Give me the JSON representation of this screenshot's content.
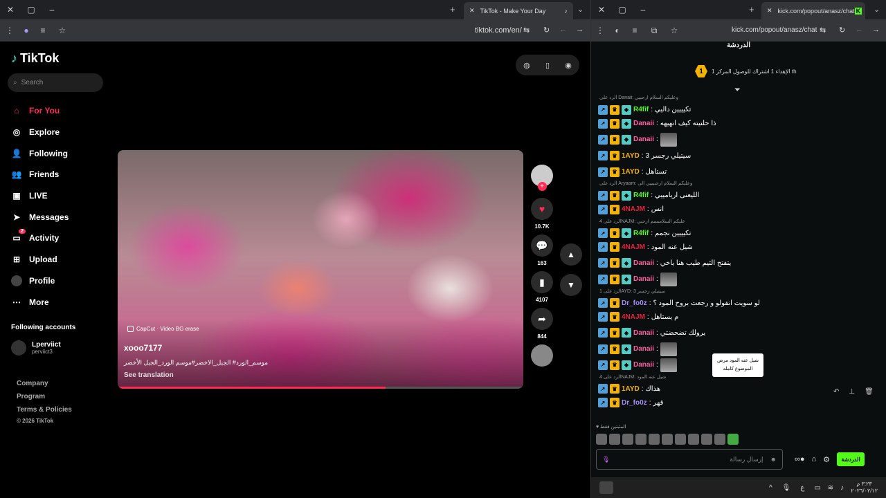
{
  "left_browser": {
    "tab_title": "TikTok - Make Your Day",
    "url": "tiktok.com/en/"
  },
  "tiktok": {
    "logo": "TikTok",
    "search_placeholder": "Search",
    "nav": [
      {
        "label": "For You",
        "icon": "home-icon",
        "active": true
      },
      {
        "label": "Explore",
        "icon": "compass-icon"
      },
      {
        "label": "Following",
        "icon": "person-icon"
      },
      {
        "label": "Friends",
        "icon": "friends-icon"
      },
      {
        "label": "LIVE",
        "icon": "live-icon"
      },
      {
        "label": "Messages",
        "icon": "send-icon"
      },
      {
        "label": "Activity",
        "icon": "activity-icon",
        "badge": "2"
      },
      {
        "label": "Upload",
        "icon": "upload-icon"
      },
      {
        "label": "Profile",
        "icon": "avatar-icon"
      },
      {
        "label": "More",
        "icon": "more-icon"
      }
    ],
    "following_title": "Following accounts",
    "following": [
      {
        "name": "Lperviict",
        "handle": "perviict3"
      }
    ],
    "footer": [
      "Company",
      "Program",
      "Terms & Policies",
      "© 2026 TikTok"
    ],
    "video": {
      "capcut": "CapCut · Video BG erase",
      "author": "xooo7177",
      "description": "موسم_الورد# الجبل_الاخضر#موسم الورد_الجبل الأخضر",
      "see_translation": "See translation",
      "progress": 0.66
    },
    "actions": {
      "likes": "10.7K",
      "comments": "163",
      "saves": "4107",
      "shares": "844"
    }
  },
  "right_browser": {
    "tab_title": "kick.com/popout/anasz/chat",
    "url": "kick.com/popout/anasz/chat"
  },
  "kick": {
    "title": "الدردشة",
    "goal_number": "1",
    "goal_text": "الإهداء 1 اشتراك للوصول المركز 1 th",
    "messages": [
      {
        "reply": "الرد على Danaii: وعليكم السلام ارحبيي",
        "user": "R4fif",
        "color": "#53fc18",
        "text": "تكيييين داليي"
      },
      {
        "user": "Danaii",
        "color": "#ff5fa2",
        "text": "ذا حلتيته كيف انهيهه"
      },
      {
        "user": "Danaii",
        "color": "#ff5fa2",
        "text": "",
        "thumb": true
      },
      {
        "user": "1AYD",
        "color": "#f5b301",
        "text": "سيتيلي رجسر 3"
      },
      {
        "user": "1AYD",
        "color": "#f5b301",
        "text": "تستاهل"
      },
      {
        "reply": "الرد على Aryaam: وعليكم السلام ارحبيييي الى",
        "user": "R4fif",
        "color": "#53fc18",
        "text": "الليعنى اريامييي"
      },
      {
        "user": "4NAJM",
        "color": "#e8203c",
        "text": "انس"
      },
      {
        "reply": "الرد على 4NAJM: عليكم السلامممم ارحبي",
        "user": "R4fif",
        "color": "#53fc18",
        "text": "تكيييين نجمم"
      },
      {
        "user": "4NAJM",
        "color": "#e8203c",
        "text": "شيل عنه المود"
      },
      {
        "user": "Danaii",
        "color": "#ff5fa2",
        "text": "يتفتح الثيم طيب هنا ياخي"
      },
      {
        "user": "Danaii",
        "color": "#ff5fa2",
        "text": "",
        "thumb": true
      },
      {
        "reply": "الرد على 1AYD: سيتيلي رجسر 3",
        "user": "Dr_fo0z",
        "color": "#a78bfa",
        "text": "لو سويت انفولو و رجعت بروح المود ؟"
      },
      {
        "user": "4NAJM",
        "color": "#e8203c",
        "text": "م يستاهل"
      },
      {
        "user": "Danaii",
        "color": "#ff5fa2",
        "text": "يرولك تضحضتي"
      },
      {
        "user": "Danaii",
        "color": "#ff5fa2",
        "text": "",
        "thumb": true
      },
      {
        "user": "Danaii",
        "color": "#ff5fa2",
        "text": "",
        "thumb": true
      },
      {
        "reply": "الرد على 4NAJM: شيل عنه المود",
        "user": "1AYD",
        "color": "#f5b301",
        "text": "هذاك"
      },
      {
        "user": "Dr_fo0z",
        "color": "#a78bfa",
        "text": "قهر"
      }
    ],
    "tooltip": "شيل عنه المود مرض الموضوع كامله",
    "pinned_label": "المثبتين فقط",
    "input_placeholder": "إرسال رسالة",
    "send_label": "الدردشة"
  },
  "taskbar": {
    "time": "٣:٢٣ م",
    "date": "٢٠٢٦/٠٢/١٢"
  },
  "colors": {
    "tiktok_red": "#fe2c55",
    "kick_green": "#53fc18"
  }
}
